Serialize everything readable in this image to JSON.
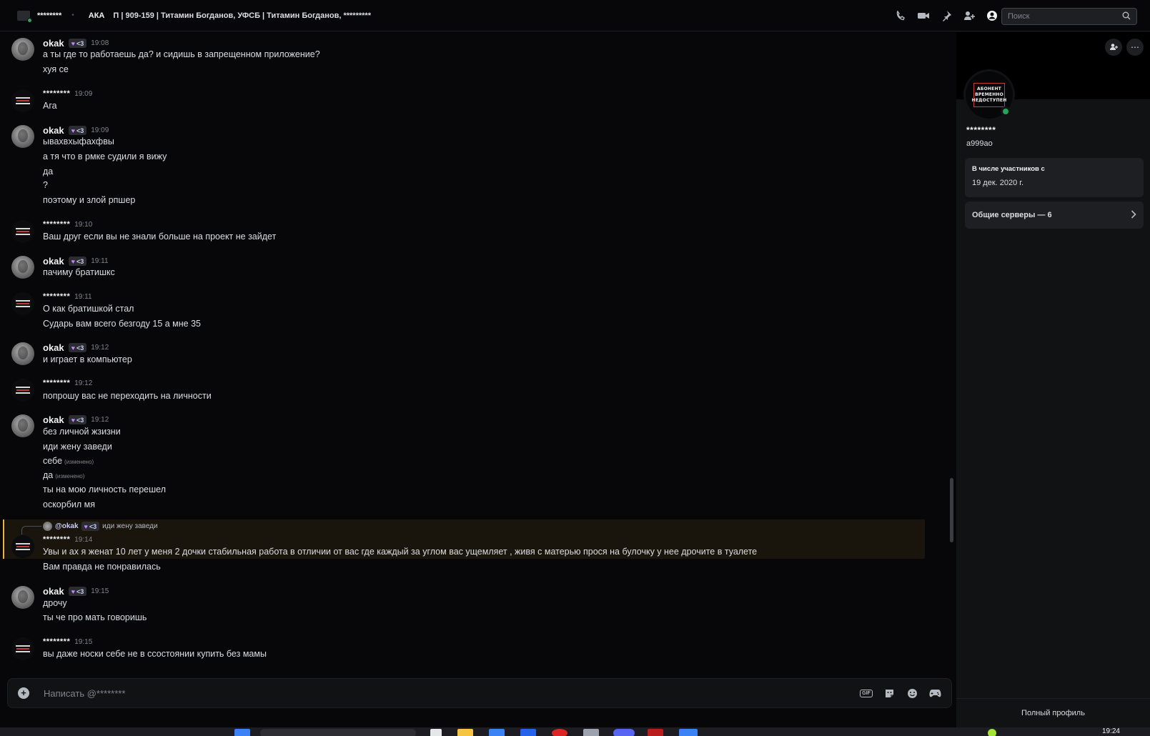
{
  "topbar": {
    "dm_name": "********",
    "group_label": "АКА",
    "group_title": "П | 909-159 | Титамин Богданов, УФСБ | Титамин Богданов, *********",
    "search_placeholder": "Поиск",
    "icons": [
      "phone-icon",
      "video-icon",
      "pin-icon",
      "add-member-icon",
      "profile-toggle-icon",
      "search-icon"
    ]
  },
  "messages": [
    {
      "author": "okak",
      "tag": "<3",
      "time": "19:08",
      "lines": [
        "а ты где то работаешь да? и сидишь в запрещенном приложение?",
        "хуя се"
      ]
    },
    {
      "author": "********",
      "time": "19:09",
      "lines": [
        "Ага"
      ]
    },
    {
      "author": "okak",
      "tag": "<3",
      "time": "19:09",
      "lines": [
        "ывахвхыфахфвы",
        "а тя что в рмке судили я вижу",
        "да",
        "?",
        "поэтому и злой рпшер"
      ]
    },
    {
      "author": "********",
      "time": "19:10",
      "lines": [
        "Ваш друг если вы не знали больше на проект не зайдет"
      ]
    },
    {
      "author": "okak",
      "tag": "<3",
      "time": "19:11",
      "lines": [
        "пачиму братишкс"
      ]
    },
    {
      "author": "********",
      "time": "19:11",
      "lines": [
        "О как братишкой стал",
        "Сударь вам всего безгоду 15 а мне 35"
      ]
    },
    {
      "author": "okak",
      "tag": "<3",
      "time": "19:12",
      "lines": [
        "и играет в компьютер"
      ]
    },
    {
      "author": "********",
      "time": "19:12",
      "lines": [
        "попрошу вас не переходить на личности"
      ]
    },
    {
      "author": "okak",
      "tag": "<3",
      "time": "19:12",
      "lines": [
        "без личной жзизни",
        "иди жену заведи",
        "себе",
        "да",
        "ты на мою личность перешел",
        "оскорбил мя"
      ],
      "edited": "(изменено)"
    },
    {
      "author": "********",
      "time": "19:14",
      "reply": {
        "mention": "@okak",
        "tag": "<3",
        "text": "иди жену заведи"
      },
      "lines": [
        "Увы и ах я женат 10 лет у меня 2 дочки стабильная работа  в отличии от вас где каждый за углом вас ущемляет , живя с матерью прося на булочку у нее дрочите в туалете",
        "Вам правда не понравилась"
      ]
    },
    {
      "author": "okak",
      "tag": "<3",
      "time": "19:15",
      "lines": [
        "дрочу",
        "ты че про мать говоришь"
      ]
    },
    {
      "author": "********",
      "time": "19:15",
      "lines": [
        "вы даже носки себе не в ссостоянии купить без мамы"
      ]
    }
  ],
  "composer": {
    "placeholder": "Написать @********",
    "gif_label": "GIF"
  },
  "profile": {
    "name": "********",
    "username": "a999ao",
    "avatar_text": [
      "АБОНЕНТ",
      "ВРЕМЕННО",
      "НЕДОСТУПЕН"
    ],
    "member_since_label": "В числе участников с",
    "member_since_value": "19 дек. 2020 г.",
    "mutual_servers": "Общие серверы — 6",
    "full_profile": "Полный профиль"
  },
  "taskbar": {
    "clock": "19:24"
  },
  "colors": {
    "background": "#070709",
    "panel": "#111214",
    "online": "#23a55a",
    "highlight": "#f0b232"
  }
}
